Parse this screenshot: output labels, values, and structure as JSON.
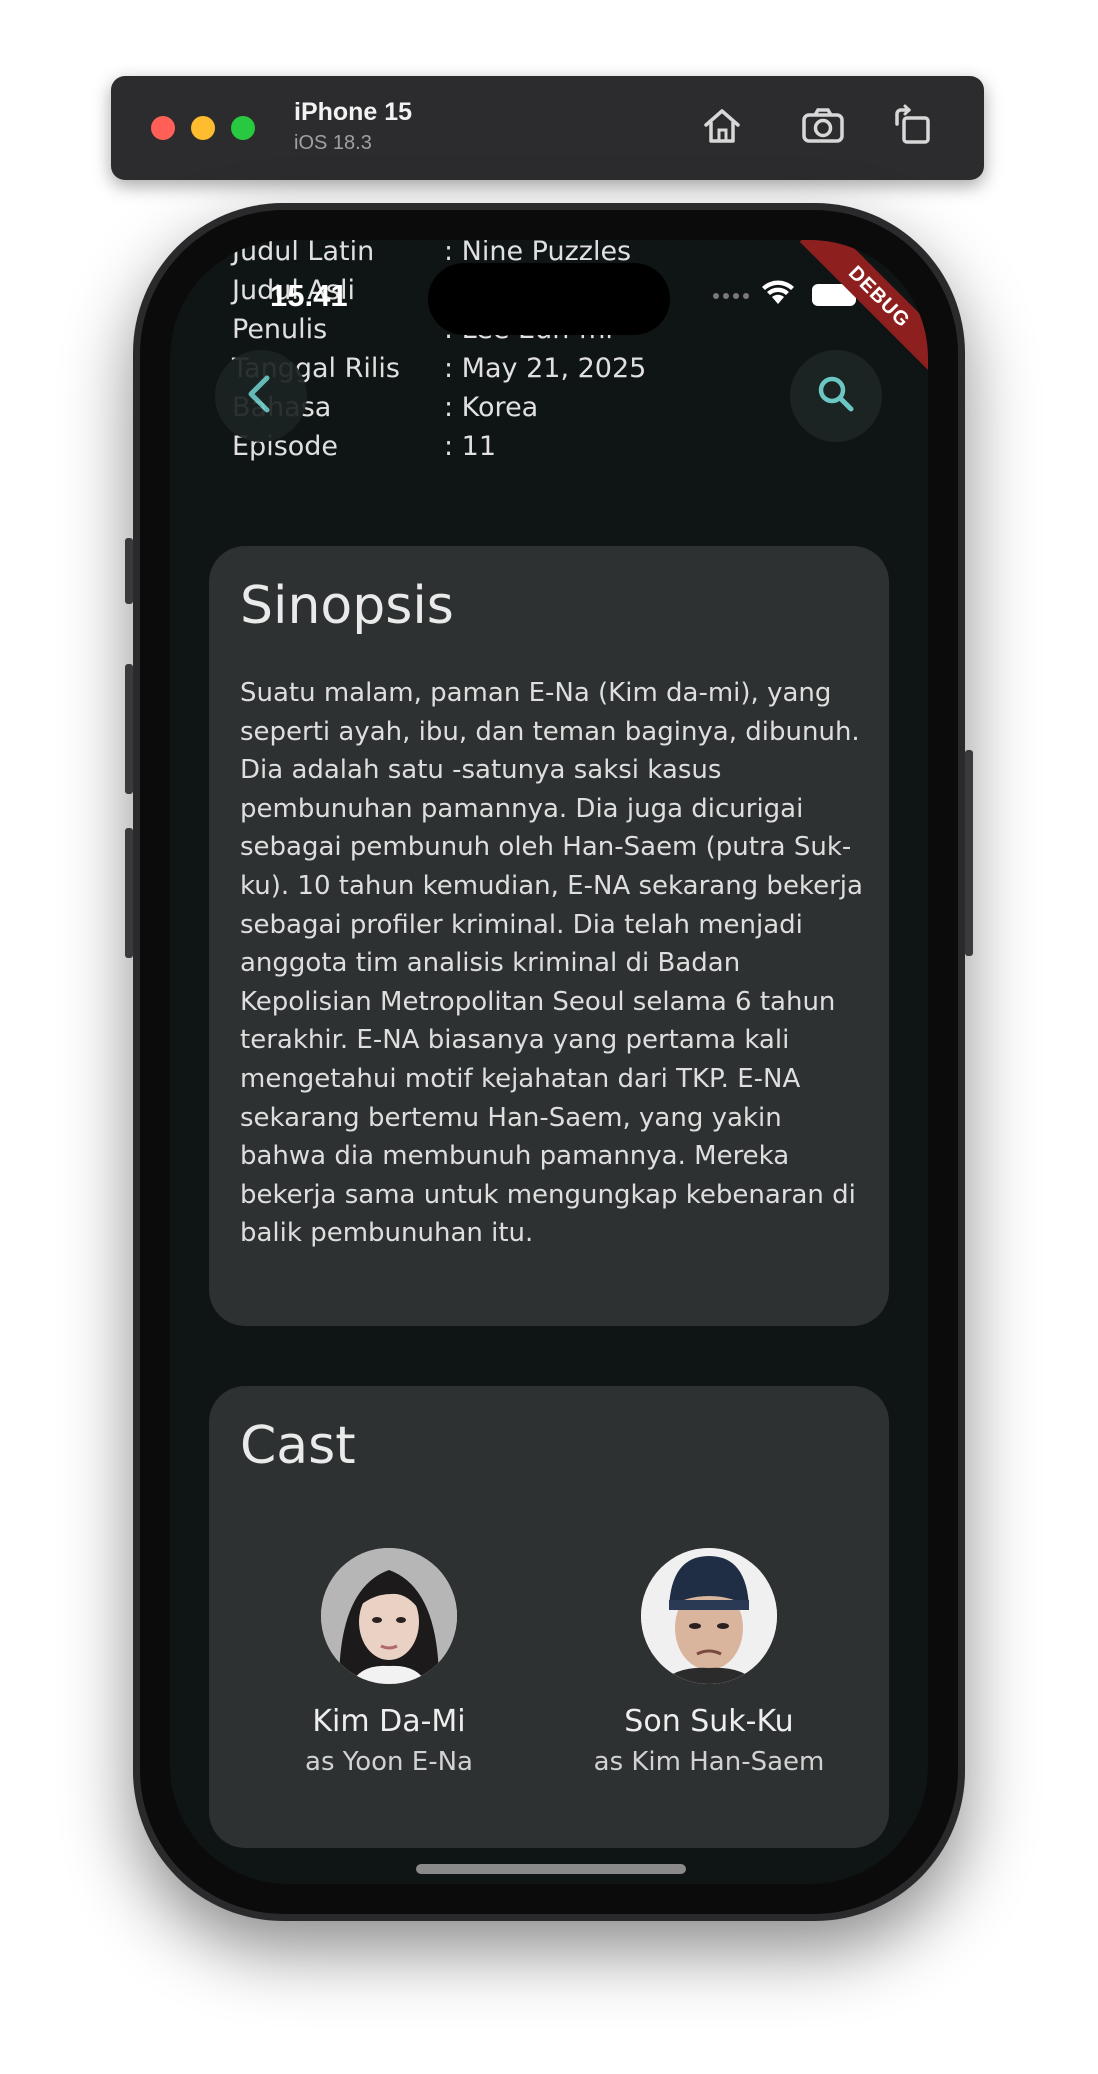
{
  "simulator": {
    "device": "iPhone 15",
    "os": "iOS 18.3",
    "icons": [
      "home-icon",
      "screenshot-icon",
      "rotate-icon"
    ]
  },
  "status_bar": {
    "time": "15.41"
  },
  "debug_banner": "DEBUG",
  "info": [
    {
      "label": "Judul Latin",
      "value": ": Nine Puzzles"
    },
    {
      "label": "Judul Asli",
      "value": ""
    },
    {
      "label": "Penulis",
      "value": ": Lee Eun-mi"
    },
    {
      "label": "Tanggal Rilis",
      "value": ": May 21, 2025"
    },
    {
      "label": "Bahasa",
      "value": ": Korea"
    },
    {
      "label": "Episode",
      "value": ": 11"
    }
  ],
  "synopsis": {
    "title": "Sinopsis",
    "text": "Suatu malam, paman E-Na (Kim da-mi), yang seperti ayah, ibu, dan teman baginya, dibunuh. Dia adalah satu -satunya saksi kasus pembunuhan pamannya. Dia juga dicurigai sebagai pembunuh oleh Han-Saem (putra Suk-ku). 10 tahun kemudian, E-NA sekarang bekerja sebagai profiler kriminal. Dia telah menjadi anggota tim analisis kriminal di Badan Kepolisian Metropolitan Seoul selama 6 tahun terakhir. E-NA biasanya yang pertama kali mengetahui motif kejahatan dari TKP. E-NA sekarang bertemu Han-Saem, yang yakin bahwa dia membunuh pamannya. Mereka bekerja sama untuk mengungkap kebenaran di balik pembunuhan itu."
  },
  "cast": {
    "title": "Cast",
    "members": [
      {
        "name": "Kim Da-Mi",
        "role": "as Yoon E-Na"
      },
      {
        "name": "Son Suk-Ku",
        "role": "as Kim Han-Saem"
      }
    ]
  },
  "colors": {
    "background": "#0f1414",
    "card": "#2d3131",
    "accent": "#6cc7c4",
    "debug": "#8e1f1f"
  }
}
